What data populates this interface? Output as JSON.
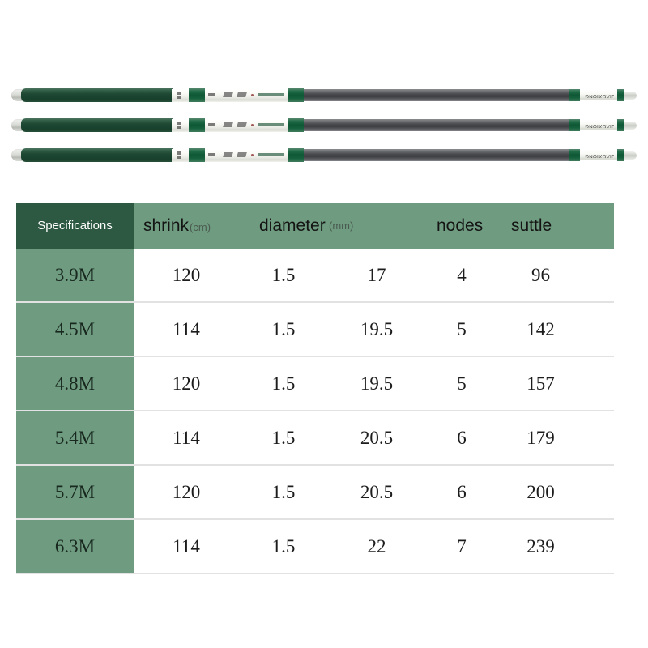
{
  "product": {
    "rod_count": 3,
    "brand_tip_text": "JIAOXIONG",
    "colors": {
      "handle_green": "#1f4833",
      "collar_green": "#0f5836",
      "carbon_gray": "#4c4d51",
      "decal_white": "#f4f5f0"
    }
  },
  "table": {
    "colors": {
      "header_spec_bg": "#2d5842",
      "header_data_bg": "#6f9c80",
      "row_spec_bg": "#6f9c80",
      "row_divider": "#e2e2e2",
      "header_text": "#ffffff",
      "body_text": "#1c1c1c"
    },
    "headers": {
      "spec": "Specifications",
      "shrink": {
        "label": "shrink",
        "unit": "(cm)"
      },
      "diameter": {
        "label": "diameter",
        "unit": "(mm)"
      },
      "nodes": {
        "label": "nodes",
        "unit": ""
      },
      "suttle": {
        "label": "suttle",
        "unit": ""
      }
    },
    "rows": [
      {
        "spec": "3.9M",
        "shrink": "120",
        "diameter_tip": "1.5",
        "diameter_butt": "17",
        "nodes": "4",
        "suttle": "96"
      },
      {
        "spec": "4.5M",
        "shrink": "114",
        "diameter_tip": "1.5",
        "diameter_butt": "19.5",
        "nodes": "5",
        "suttle": "142"
      },
      {
        "spec": "4.8M",
        "shrink": "120",
        "diameter_tip": "1.5",
        "diameter_butt": "19.5",
        "nodes": "5",
        "suttle": "157"
      },
      {
        "spec": "5.4M",
        "shrink": "114",
        "diameter_tip": "1.5",
        "diameter_butt": "20.5",
        "nodes": "6",
        "suttle": "179"
      },
      {
        "spec": "5.7M",
        "shrink": "120",
        "diameter_tip": "1.5",
        "diameter_butt": "20.5",
        "nodes": "6",
        "suttle": "200"
      },
      {
        "spec": "6.3M",
        "shrink": "114",
        "diameter_tip": "1.5",
        "diameter_butt": "22",
        "nodes": "7",
        "suttle": "239"
      }
    ]
  }
}
